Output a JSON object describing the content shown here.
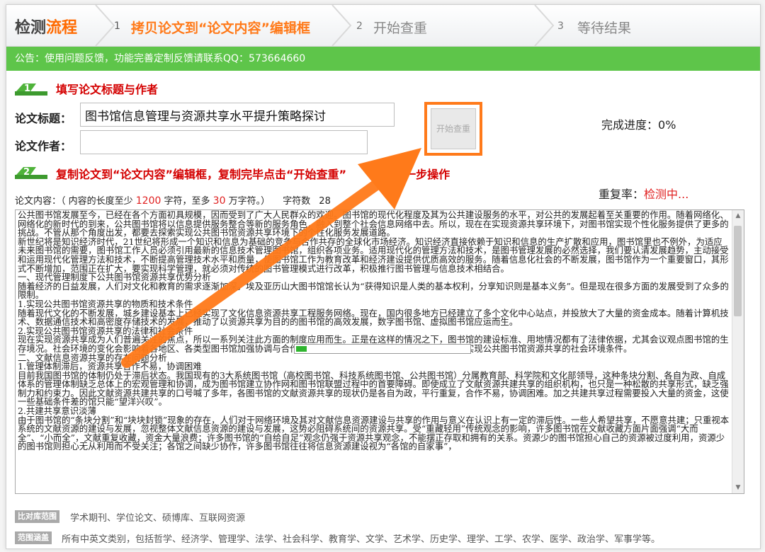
{
  "steps": {
    "title_prefix": "检测",
    "title_highlight": "流程",
    "items": [
      {
        "num": "1",
        "label": "拷贝论文到“论文内容”编辑框"
      },
      {
        "num": "2",
        "label": "开始查重"
      },
      {
        "num": "3",
        "label": "等待结果"
      }
    ]
  },
  "notice": "公告：使用问题反馈，功能完善定制反馈请联系QQ：573664660",
  "section1": {
    "title": "填写论文标题与作者"
  },
  "form": {
    "title_label": "论文标题：",
    "title_value": "图书馆信息管理与资源共享水平提升策略探讨",
    "author_label": "论文作者：",
    "author_value": ""
  },
  "start_button": "开始查重",
  "progress": {
    "label": "完成进度：",
    "value": "0%"
  },
  "section2": {
    "title": "复制论文到“论文内容”编辑框，复制完毕点击“开始查重”",
    "title_tail": "进入下一步操作"
  },
  "duplicate": {
    "label": "重复率：",
    "value": "检测中..."
  },
  "content_info": {
    "prefix": "论文内容：（ 内容的长度至少 ",
    "min": "1200",
    "middle": " 字符，至多 ",
    "max": "30",
    "suffix": " 万字符。）",
    "count_label": "字符数",
    "count_tail": "28"
  },
  "content_text": "公共图书馆发展至今，已经在各个方面初具规模，因而受到了广大人民群众的欢迎。图书馆的现代化程度及其为公共建设服务的水平，对公共的发展起着至关重要的作用。随着网络化、网络化的新时代的到来，公共图书馆将以信息提供服务整合等新的服务角色，融入到整个社会信息网络中去。所以，现在在实现资源共享环境下，对图书馆实现个性化服务提供了更多的挑战。不管从那个角度出发，都要去探索实现公共图书馆资源共享环境下的个性化服务发展道路。\n新世纪将是知识经济时代，21世纪将形成一个知识和信息为基础的竞争与合作共存的全球化市场经济。知识经济直接依赖于知识和信息的生产扩散和应用，图书馆里也不例外，为适应未来图书馆的需要，图书馆工作人员必须引用最新的信息技术管理图书馆，组织各项业务。适用现代化的管理方法和技术，是图书管理发展的必然选择，我们要认清发展趋势，主动接受和运用现代化管理方法和技术，不断提高管理技术水平和质量，使图书馆工作为教育改革和经济建设提供优质高效的服务。随着信息化社会的不断发展，图书馆作为一个重要窗口，其形式不断增加，范围正在扩大，要实现科学管理，就必须对传统的图书管理模式进行改革，积极推行图书管理与信息技术相结合。\n一、现代管理制度下公共图书馆资源共享优势分析\n随着经济的日益发展，人们对文化和教育的需求逐渐加深。埃及亚历山大图书馆馆长认为“获得知识是人类的基本权利，分享知识则是基本义务”。但是现在很多方面的发展受到了众多的限制。\n1.实现公共图书馆资源共享的物质和技术条件\n随着现代文化的不断发展，城乡建设基本上已经实现了文化信息资源共享工程服务网络。现在，国内很多地方已经建立了多个文化中心站点，并投放大了大量的资金成本。随着计算机技术、数据通信技术和高密度存储技术的发展，推动了以资源共享为目的的图书馆的高效发展，数字图书馆、虚拟图书馆应运而生。\n2.实现公共图书馆资源共享的法律和社会条件\n现在实现资源共享成为人们普遍关注的焦点，所以一系列关注此方面的制度应用而生。正是在这样的情况之下，图书馆的建设标准、用地情况都有了法律依据，尤其会议观点图书馆的生存境况。社会环境的变化会影响着各地区、各类型图书馆加强协调与合作。促进全社会信息资源的有效利用，构成了实现公共图书馆资源共享的社会环境条件。\n二、文献信息资源共享的存在问题分析\n1.管理体制滞后，资源共享合作不易，协调困难\n目前我国图书馆的体制仍处于滞后状态。我国现有的3大系统图书馆（高校图书馆、科技系统图书馆、公共图书馆）分属教育部、科学院和文化部领导，这种条块分割、各自为政、自成体系的管理体制缺乏总体上的宏观管理和协调，成为图书馆建立协作网和图书馆联盟过程中的首要障碍。即使成立了文献资源共建共享的组织机构，也只是一种松散的共享形式，缺乏强制力和约束力。因此文献资源共建共享的口号喊了多年，各图书馆的文献资源共享的现状仍是各自为政，平行重复，合作不易，协调困难。加之共建共享过程需要投入大量的资金，这使一些基础条件差的馆只能“望洋兴叹”。\n2.共建共享意识淡薄\n由于图书馆的“条块分割”和“块块封锁”现象的存在，人们对于网络环境及其对文献信息资源建设与共享的作用与意义在认识上有一定的滞后性。一些人希望共享，不愿意共建；只重视本系统的文献资源的建设与发展，忽视整体文献信息资源的建设与发展，这势必阻碍系统间的资源共享。受“重藏轻用”传统观念的影响，许多图书馆在文献收藏方面片面强调“大而全”、“小而全”，文献重复收藏，资金大量浪费；许多图书馆的“自给自足”观念仍强于资源共享观念，不能摆正存取和拥有的关系。资源少的图书馆担心自己的资源被过度利用，资源少的图书馆则担心无从利用而不受关注；各馆之间缺少协作，许多图书馆往往将信息资源建设视为“各馆的自家事”，",
  "footer": {
    "compare_tag": "比对库范围",
    "compare_text": "学术期刊、学位论文、硕博库、互联网资源",
    "scope_tag": "范围涵盖",
    "scope_text": "所有中英文类别，包括哲学、经济学、管理学、法学、社会科学、教育学、文学、艺术学、历史学、理学、工学、农学、医学、政治学、军事学等。"
  },
  "loading_progress_fraction": 0.06,
  "colors": {
    "accent": "#ff7a1a",
    "notice_bg": "#5ec54a",
    "section_red": "#d40000",
    "badge_green": "#3d9a2e"
  }
}
